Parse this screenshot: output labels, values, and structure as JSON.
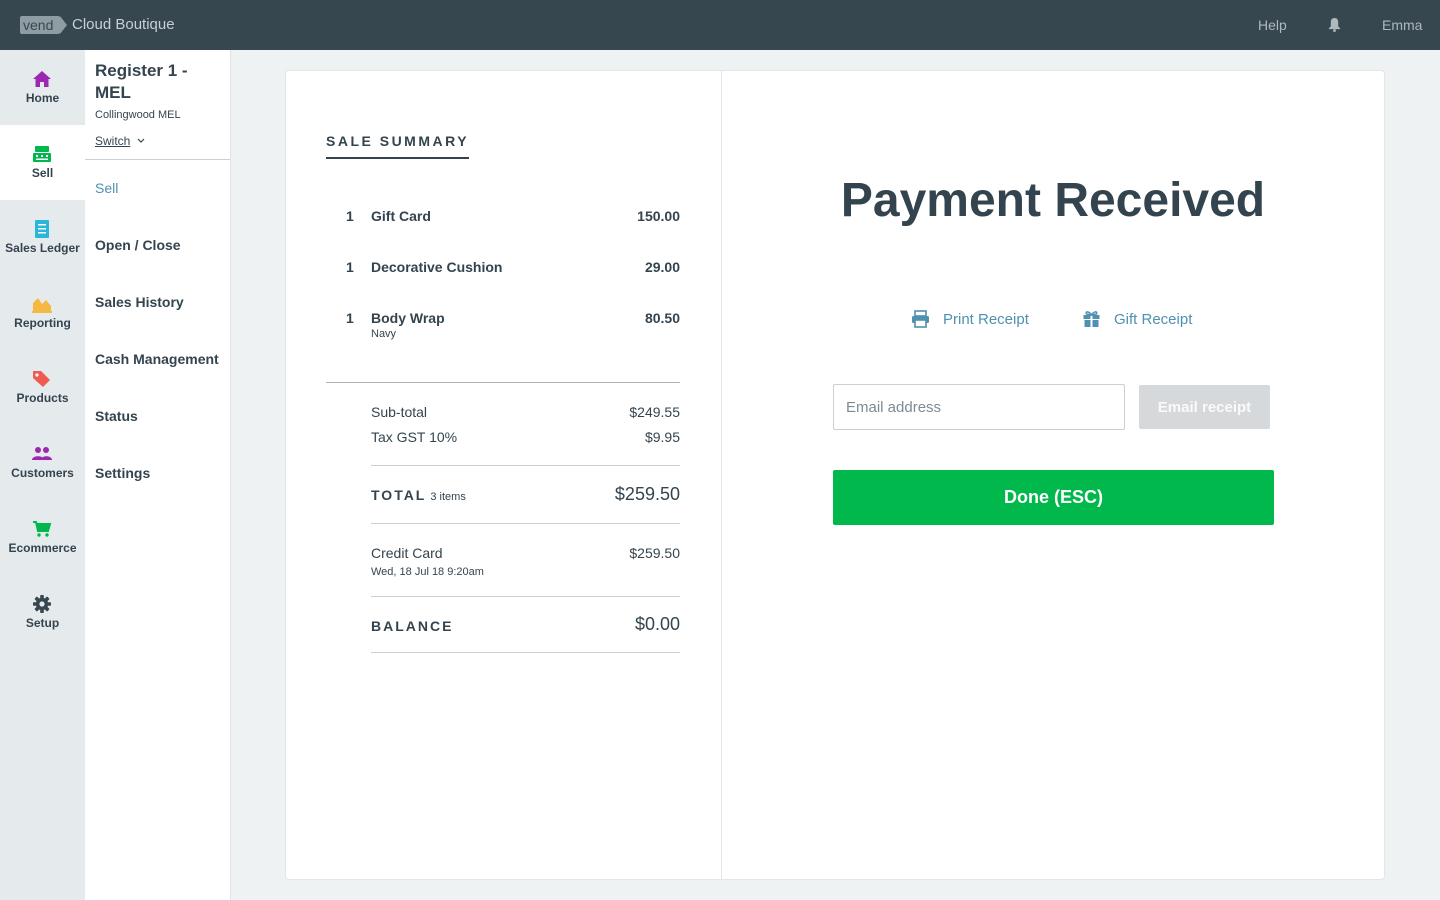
{
  "topbar": {
    "logo_text": "vend",
    "store_name": "Cloud Boutique",
    "help_label": "Help",
    "user_name": "Emma"
  },
  "leftnav": {
    "items": [
      {
        "label": "Home",
        "icon": "home-icon",
        "color": "#9c27b0"
      },
      {
        "label": "Sell",
        "icon": "register-icon",
        "color": "#00b84c",
        "active": true
      },
      {
        "label": "Sales Ledger",
        "icon": "ledger-icon",
        "color": "#29b6d8"
      },
      {
        "label": "Reporting",
        "icon": "chart-icon",
        "color": "#f5b942"
      },
      {
        "label": "Products",
        "icon": "tag-icon",
        "color": "#f05a4f"
      },
      {
        "label": "Customers",
        "icon": "customers-icon",
        "color": "#9c27b0"
      },
      {
        "label": "Ecommerce",
        "icon": "cart-icon",
        "color": "#00b84c"
      },
      {
        "label": "Setup",
        "icon": "gear-icon",
        "color": "#37474f"
      }
    ]
  },
  "subnav": {
    "register_title": "Register 1 - MEL",
    "outlet": "Collingwood MEL",
    "switch_label": "Switch",
    "items": [
      {
        "label": "Sell",
        "active": true
      },
      {
        "label": "Open / Close"
      },
      {
        "label": "Sales History"
      },
      {
        "label": "Cash Management"
      },
      {
        "label": "Status"
      },
      {
        "label": "Settings"
      }
    ]
  },
  "sale_summary": {
    "heading": "SALE SUMMARY",
    "lines": [
      {
        "qty": "1",
        "name": "Gift Card",
        "variant": "",
        "price": "150.00"
      },
      {
        "qty": "1",
        "name": "Decorative Cushion",
        "variant": "",
        "price": "29.00"
      },
      {
        "qty": "1",
        "name": "Body Wrap",
        "variant": "Navy",
        "price": "80.50"
      }
    ],
    "subtotal_label": "Sub-total",
    "subtotal_value": "$249.55",
    "tax_label": "Tax GST 10%",
    "tax_value": "$9.95",
    "total_label": "TOTAL",
    "total_items": "3 items",
    "total_value": "$259.50",
    "payment_label": "Credit Card",
    "payment_date": "Wed, 18 Jul 18 9:20am",
    "payment_value": "$259.50",
    "balance_label": "BALANCE",
    "balance_value": "$0.00"
  },
  "payment": {
    "title": "Payment Received",
    "print_receipt_label": "Print Receipt",
    "gift_receipt_label": "Gift Receipt",
    "email_placeholder": "Email address",
    "email_button_label": "Email receipt",
    "done_label": "Done (ESC)",
    "accent_color": "#00b84c",
    "link_color": "#4f91b0"
  }
}
